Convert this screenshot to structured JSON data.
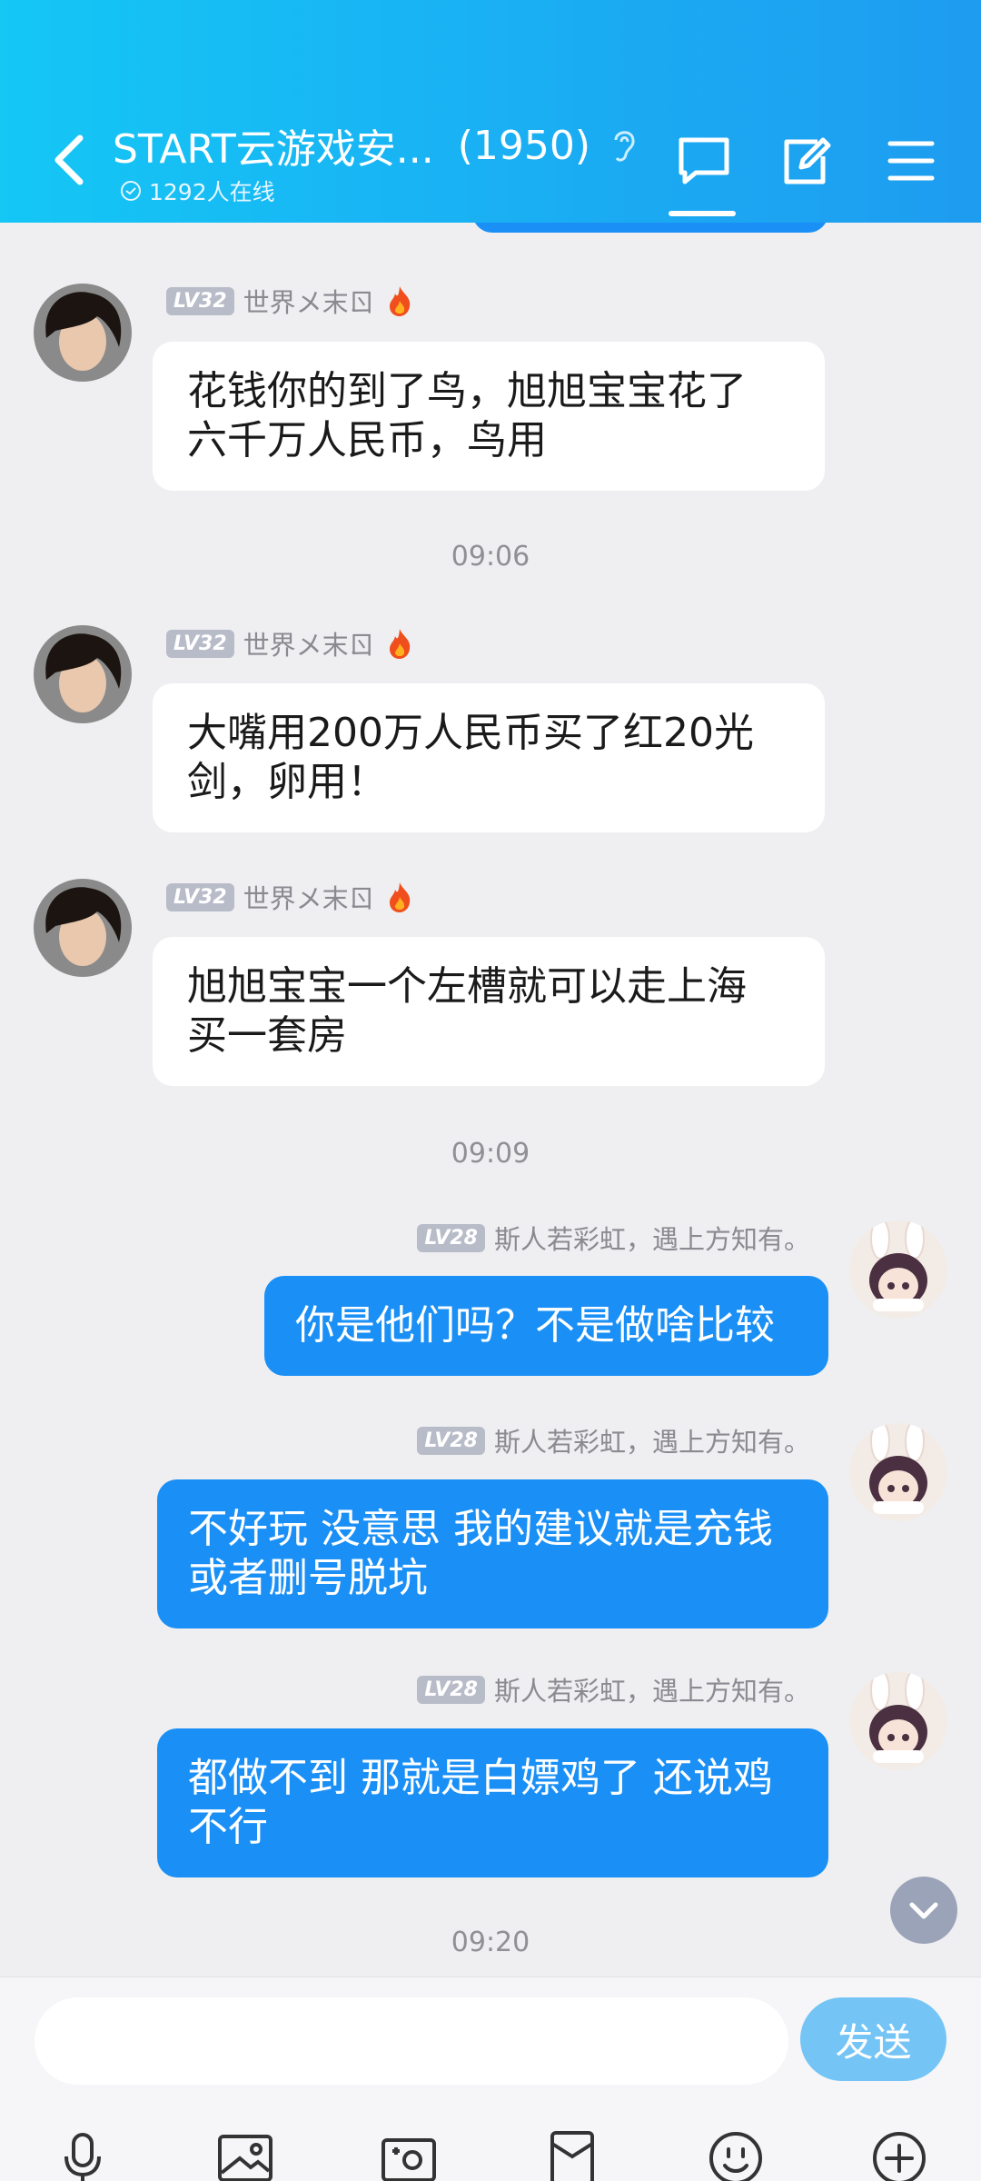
{
  "header": {
    "title": "START云游戏安...",
    "member_count": "(1950)",
    "online": "1292人在线"
  },
  "messages": [
    {
      "level": "LV32",
      "name": "世界メ末ㄖ",
      "text_lines": [
        "花钱你的到了鸟，旭旭宝宝花了",
        "六千万人民币，鸟用"
      ]
    },
    {
      "level": "LV32",
      "name": "世界メ末ㄖ",
      "text_lines": [
        "大嘴用200万人民币买了红20光",
        "剑，卵用！"
      ]
    },
    {
      "level": "LV32",
      "name": "世界メ末ㄖ",
      "text_lines": [
        "旭旭宝宝一个左槽就可以走上海",
        "买一套房"
      ]
    },
    {
      "level": "LV28",
      "name": "斯人若彩虹，遇上方知有。",
      "text_lines": [
        "你是他们吗？不是做啥比较"
      ]
    },
    {
      "level": "LV28",
      "name": "斯人若彩虹，遇上方知有。",
      "text_lines": [
        "不好玩 没意思 我的建议就是充钱",
        "或者删号脱坑"
      ]
    },
    {
      "level": "LV28",
      "name": "斯人若彩虹，遇上方知有。",
      "text_lines": [
        "都做不到 那就是白嫖鸡了 还说鸡",
        "不行"
      ]
    }
  ],
  "timestamps": [
    "09:06",
    "09:09",
    "09:20"
  ],
  "input": {
    "value": "",
    "send_label": "发送"
  },
  "toolbar": [
    "mic-icon",
    "image-icon",
    "camera-icon",
    "red-packet-icon",
    "emoji-icon",
    "plus-icon"
  ],
  "colors": {
    "header": "#1aaef3",
    "own_bubble": "#1a8ff6",
    "send_button": "#74c4f6"
  }
}
